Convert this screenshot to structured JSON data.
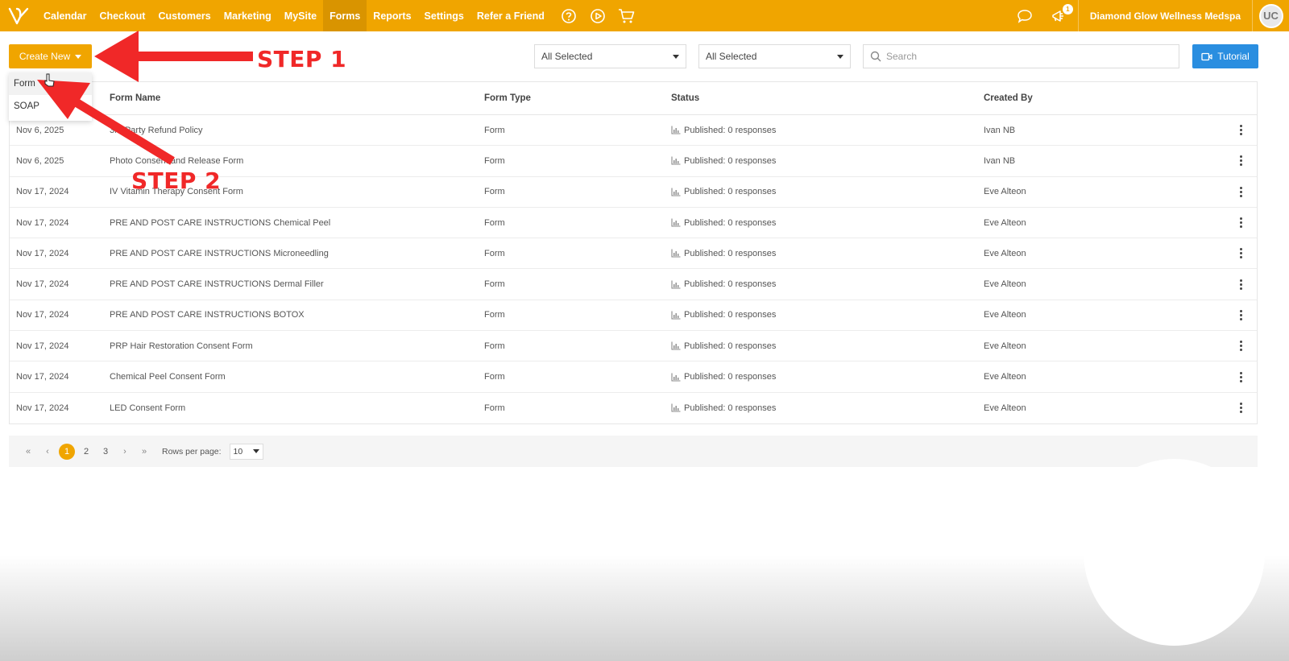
{
  "nav": {
    "items": [
      {
        "label": "Calendar",
        "active": false
      },
      {
        "label": "Checkout",
        "active": false
      },
      {
        "label": "Customers",
        "active": false
      },
      {
        "label": "Marketing",
        "active": false
      },
      {
        "label": "MySite",
        "active": false
      },
      {
        "label": "Forms",
        "active": true
      },
      {
        "label": "Reports",
        "active": false
      },
      {
        "label": "Settings",
        "active": false
      },
      {
        "label": "Refer a Friend",
        "active": false
      }
    ],
    "notification_count": "1",
    "business_name": "Diamond Glow Wellness Medspa",
    "avatar_initials": "UC"
  },
  "toolbar": {
    "create_label": "Create New",
    "filter1": "All Selected",
    "filter2": "All Selected",
    "search_placeholder": "Search",
    "tutorial_label": "Tutorial"
  },
  "dropdown": {
    "items": [
      "Form",
      "SOAP"
    ]
  },
  "table": {
    "headers": {
      "date": "",
      "name": "Form Name",
      "type": "Form Type",
      "status": "Status",
      "created_by": "Created By"
    },
    "rows": [
      {
        "date": "Nov 6, 2025",
        "name": "3rd Party Refund Policy",
        "type": "Form",
        "status": "Published: 0 responses",
        "created_by": "Ivan NB"
      },
      {
        "date": "Nov 6, 2025",
        "name": "Photo Consent and Release Form",
        "type": "Form",
        "status": "Published: 0 responses",
        "created_by": "Ivan NB"
      },
      {
        "date": "Nov 17, 2024",
        "name": "IV Vitamin Therapy Consent Form",
        "type": "Form",
        "status": "Published: 0 responses",
        "created_by": "Eve Alteon"
      },
      {
        "date": "Nov 17, 2024",
        "name": "PRE AND POST CARE INSTRUCTIONS Chemical Peel",
        "type": "Form",
        "status": "Published: 0 responses",
        "created_by": "Eve Alteon"
      },
      {
        "date": "Nov 17, 2024",
        "name": "PRE AND POST CARE INSTRUCTIONS Microneedling",
        "type": "Form",
        "status": "Published: 0 responses",
        "created_by": "Eve Alteon"
      },
      {
        "date": "Nov 17, 2024",
        "name": "PRE AND POST CARE INSTRUCTIONS Dermal Filler",
        "type": "Form",
        "status": "Published: 0 responses",
        "created_by": "Eve Alteon"
      },
      {
        "date": "Nov 17, 2024",
        "name": "PRE AND POST CARE INSTRUCTIONS BOTOX",
        "type": "Form",
        "status": "Published: 0 responses",
        "created_by": "Eve Alteon"
      },
      {
        "date": "Nov 17, 2024",
        "name": "PRP Hair Restoration Consent Form",
        "type": "Form",
        "status": "Published: 0 responses",
        "created_by": "Eve Alteon"
      },
      {
        "date": "Nov 17, 2024",
        "name": "Chemical Peel Consent Form",
        "type": "Form",
        "status": "Published: 0 responses",
        "created_by": "Eve Alteon"
      },
      {
        "date": "Nov 17, 2024",
        "name": "LED Consent Form",
        "type": "Form",
        "status": "Published: 0 responses",
        "created_by": "Eve Alteon"
      }
    ]
  },
  "pagination": {
    "pages": [
      "1",
      "2",
      "3"
    ],
    "current": "1",
    "rows_label": "Rows per page:",
    "rows_value": "10"
  },
  "annotations": {
    "step1": "STEP 1",
    "step2": "STEP 2",
    "color": "#f02828"
  },
  "colors": {
    "brand": "#f0a500",
    "accent_blue": "#2a8ee0"
  }
}
